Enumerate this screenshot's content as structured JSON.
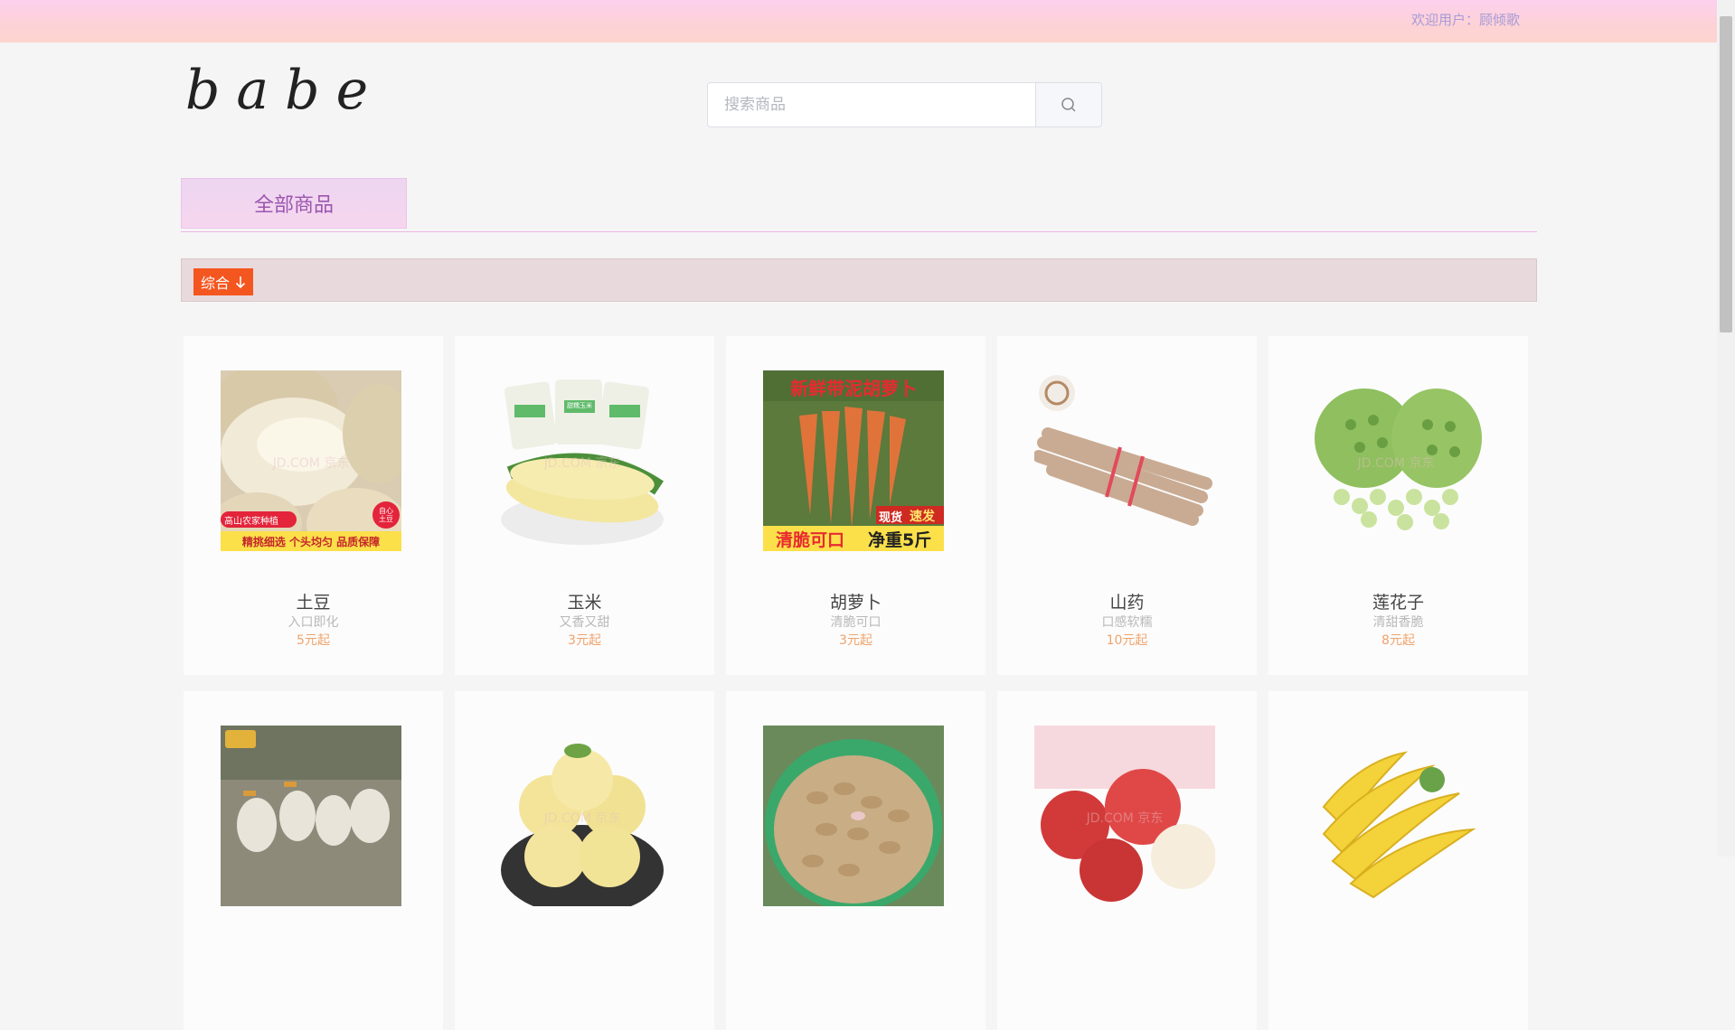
{
  "header": {
    "welcome_prefix": "欢迎用户：",
    "username": "顾倾歌"
  },
  "logo": {
    "text": "babe"
  },
  "search": {
    "placeholder": "搜索商品"
  },
  "category": {
    "label": "全部商品"
  },
  "sort": {
    "label": "综合"
  },
  "watermark": "JD.COM 京东",
  "products": [
    {
      "name": "土豆",
      "desc": "入口即化",
      "price": "5元起",
      "badge1": "高山农家种植",
      "badge2": "精挑细选 个头均匀 品质保障",
      "badge3": "自心土豆"
    },
    {
      "name": "玉米",
      "desc": "又香又甜",
      "price": "3元起",
      "pack_label": "甜糯玉米"
    },
    {
      "name": "胡萝卜",
      "desc": "清脆可口",
      "price": "3元起",
      "headline": "新鲜带泥胡萝卜",
      "tag1": "现货",
      "tag2": "速发",
      "bottom_left": "清脆可口",
      "bottom_right": "净重5斤"
    },
    {
      "name": "山药",
      "desc": "口感软糯",
      "price": "10元起"
    },
    {
      "name": "莲花子",
      "desc": "清甜香脆",
      "price": "8元起"
    },
    {
      "name": "",
      "desc": "",
      "price": ""
    },
    {
      "name": "",
      "desc": "",
      "price": ""
    },
    {
      "name": "",
      "desc": "",
      "price": ""
    },
    {
      "name": "",
      "desc": "",
      "price": ""
    },
    {
      "name": "",
      "desc": "",
      "price": ""
    }
  ],
  "colors": {
    "accent_orange": "#f4561f",
    "tab_text": "#9b56b0",
    "price": "#f0a36b"
  }
}
